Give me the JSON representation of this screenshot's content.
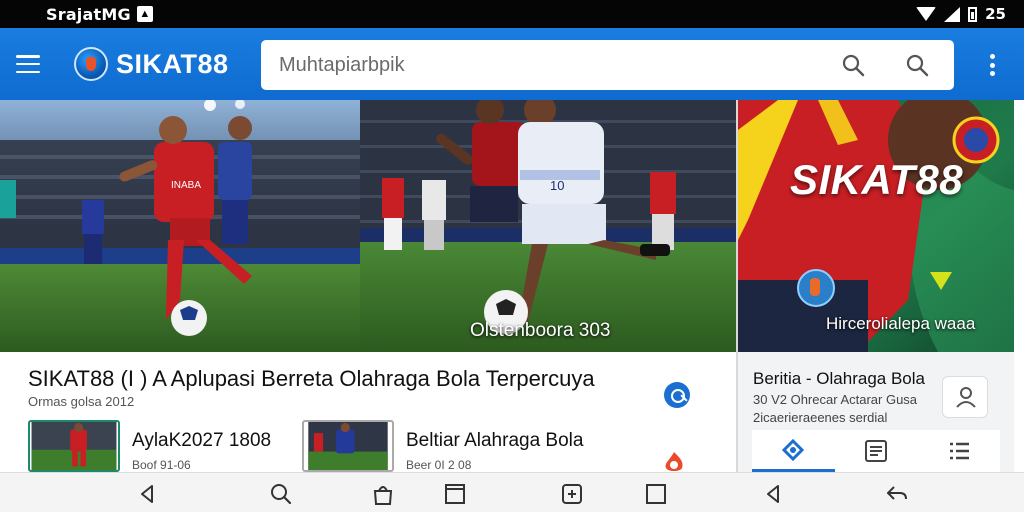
{
  "status_bar": {
    "title": "SrajatMG",
    "badge_text": "▲",
    "right_text": "25"
  },
  "app_bar": {
    "brand": "SIKAT88",
    "search_placeholder": "Muhtapiarbpik"
  },
  "hero": {
    "panel2_caption": "Olstenboora 303",
    "panel3_brand": "SIKAT88",
    "panel3_caption": "Hircerolialepa waaa",
    "jersey_text": "INABA",
    "player_number": "10"
  },
  "main": {
    "title": "SIKAT88 (I ) A Aplupasi Berreta Olahraga Bola Terpercuya",
    "subtitle": "Ormas golsa 2012"
  },
  "cards": [
    {
      "title": "AylaK2027 1808",
      "meta": "Boof 91-06"
    },
    {
      "title": "Beltiar Alahraga Bola",
      "meta": "Beer 0I 2 08"
    }
  ],
  "right_panel": {
    "title": "Beritia - Olahraga Bola",
    "line1": "30 V2 Ohrecar Actarar Gusa",
    "line2": "2icaerieraeenes serdial"
  },
  "colors": {
    "app_bar": "#1373d8",
    "accent": "#1a6fd0",
    "jersey_red": "#c81f24",
    "pitch_green": "#3e7d2c"
  },
  "icons": {
    "menu": "hamburger-icon",
    "search": "search-icon",
    "more": "kebab-icon",
    "share": "share-icon",
    "user": "user-icon",
    "nav": [
      "back-icon",
      "search-icon",
      "bag-icon",
      "square-icon",
      "scan-icon",
      "overview-icon",
      "back-icon",
      "undo-icon"
    ]
  }
}
